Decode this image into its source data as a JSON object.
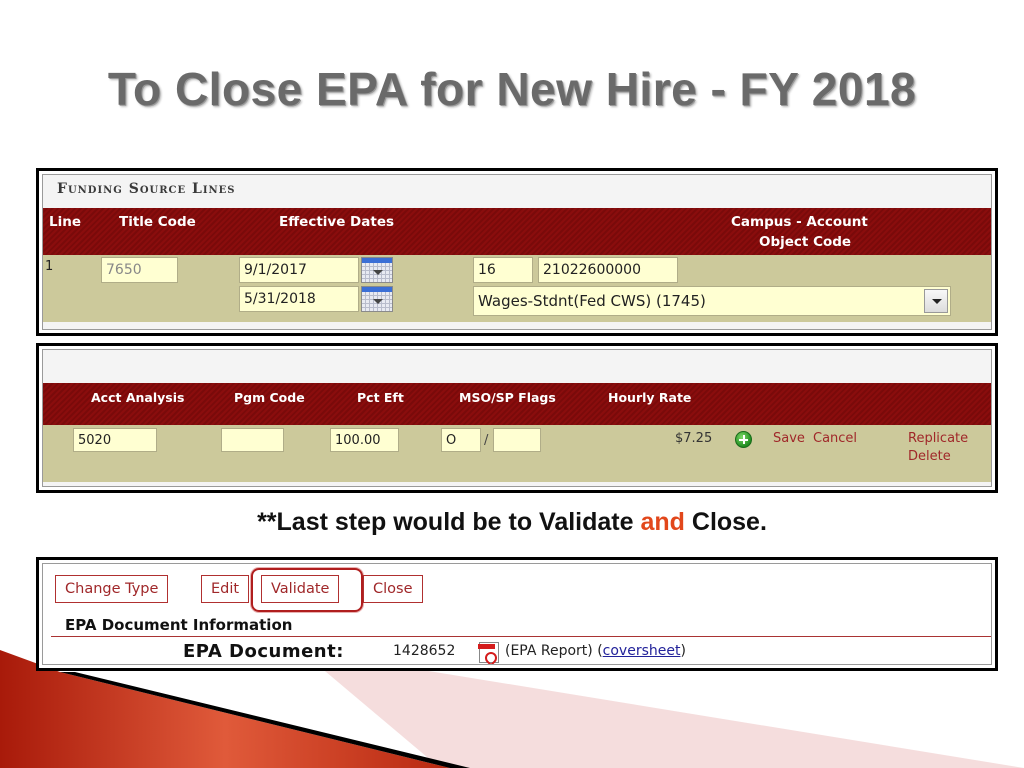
{
  "slide": {
    "title": "To Close EPA for New Hire - FY 2018",
    "note_prefix": "**Last step would be to Validate ",
    "note_accent": "and",
    "note_suffix": " Close.",
    "accent_color": "#e2471b"
  },
  "funding_source_lines": {
    "section_title": "Funding Source Lines",
    "headers": {
      "line": "Line",
      "title_code": "Title Code",
      "effective_dates": "Effective Dates",
      "campus_account_line1": "Campus - Account",
      "campus_account_line2": "Object Code"
    },
    "row": {
      "line": "1",
      "title_code": "7650",
      "start_date": "9/1/2017",
      "end_date": "5/31/2018",
      "campus": "16",
      "account": "21022600000",
      "object_code_selected": "Wages-Stdnt(Fed CWS) (1745)"
    },
    "icons": {
      "calendar": "calendar-picker-icon",
      "dropdown": "chevron-down-icon"
    }
  },
  "distribution": {
    "headers": {
      "acct_analysis": "Acct Analysis",
      "pgm_code": "Pgm Code",
      "pct_eft": "Pct Eft",
      "mso_sp_flags": "MSO/SP Flags",
      "hourly_rate": "Hourly Rate"
    },
    "row": {
      "acct_analysis": "5020",
      "pgm_code": "",
      "pct_eft": "100.00",
      "mso_flag": "O",
      "flag_separator": "/",
      "sp_flag": "",
      "hourly_rate": "$7.25"
    },
    "actions": {
      "add_icon": "plus-circle-icon",
      "save": "Save",
      "cancel": "Cancel",
      "replicate": "Replicate",
      "delete": "Delete"
    }
  },
  "epa_toolbar": {
    "buttons": [
      "Change Type",
      "Edit",
      "Validate",
      "Close"
    ],
    "highlighted": "Validate",
    "info_title": "EPA Document Information",
    "doc_label": "EPA Document:",
    "doc_number": "1428652",
    "doc_icon": "pdf-icon",
    "report_prefix": "(EPA Report) (",
    "report_link": "coversheet",
    "report_suffix": ")"
  },
  "colors": {
    "header_maroon": "#8a0d0d",
    "row_khaki": "#ccc99b",
    "input_yellow": "#ffffd2",
    "link_red": "#a0282a"
  }
}
